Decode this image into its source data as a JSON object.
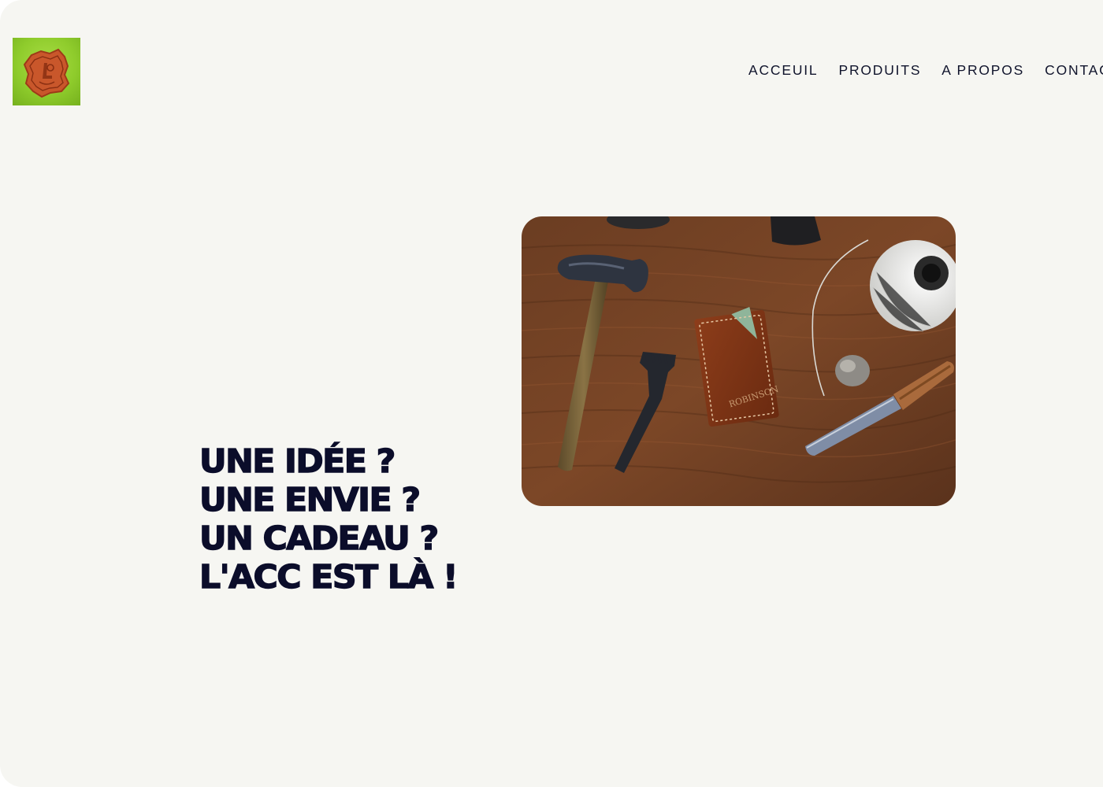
{
  "header": {
    "logo_icon": "leather-stamp-logo-icon",
    "nav": [
      {
        "label": "ACCEUIL"
      },
      {
        "label": "PRODUITS"
      },
      {
        "label": "A PROPOS"
      },
      {
        "label": "CONTACT"
      }
    ]
  },
  "hero": {
    "image_icon": "leather-tools-photo",
    "headline": [
      "UNE IDÉE ?",
      "UNE ENVIE ?",
      "UN CADEAU ?",
      "L'ACC EST LÀ !"
    ]
  },
  "colors": {
    "background": "#f6f6f2",
    "text": "#0b0d2a",
    "logo_green": "#8fcc2c",
    "logo_leather": "#c45a2e"
  }
}
